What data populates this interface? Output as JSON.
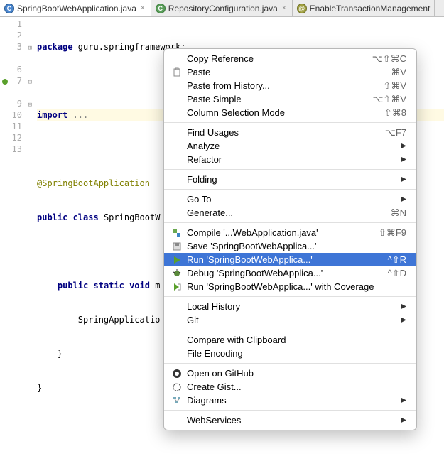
{
  "tabs": [
    {
      "label": "SpringBootWebApplication.java",
      "icon": "C",
      "iconClass": "file-icon-java"
    },
    {
      "label": "RepositoryConfiguration.java",
      "icon": "C",
      "iconClass": "file-icon-intf"
    },
    {
      "label": "EnableTransactionManagement",
      "icon": "@",
      "iconClass": "file-icon-ann"
    }
  ],
  "gutter": [
    "1",
    "2",
    "3",
    "",
    "6",
    "7",
    "",
    "9",
    "10",
    "11",
    "12",
    "13"
  ],
  "code": {
    "l1_kw": "package",
    "l1_rest": " guru.springframework;",
    "l3_kw": "import",
    "l3_rest": " ...",
    "l6": "@SpringBootApplication",
    "l7_kw1": "public",
    "l7_kw2": " class",
    "l7_rest": " SpringBootW",
    "l9_kw1": "public",
    "l9_kw2": " static",
    "l9_kw3": " void",
    "l9_rest": " m",
    "l10": "        SpringApplicatio",
    "l11": "    }",
    "l12": "}"
  },
  "menu": {
    "copy_reference": "Copy Reference",
    "copy_reference_sc": "⌥⇧⌘C",
    "paste": "Paste",
    "paste_sc": "⌘V",
    "paste_history": "Paste from History...",
    "paste_history_sc": "⇧⌘V",
    "paste_simple": "Paste Simple",
    "paste_simple_sc": "⌥⇧⌘V",
    "column_mode": "Column Selection Mode",
    "column_mode_sc": "⇧⌘8",
    "find_usages": "Find Usages",
    "find_usages_sc": "⌥F7",
    "analyze": "Analyze",
    "refactor": "Refactor",
    "folding": "Folding",
    "goto": "Go To",
    "generate": "Generate...",
    "generate_sc": "⌘N",
    "compile": "Compile '...WebApplication.java'",
    "compile_sc": "⇧⌘F9",
    "save": "Save 'SpringBootWebApplica...'",
    "run": "Run 'SpringBootWebApplica...'",
    "run_sc": "^⇧R",
    "debug": "Debug 'SpringBootWebApplica...'",
    "debug_sc": "^⇧D",
    "run_coverage": "Run 'SpringBootWebApplica...' with Coverage",
    "local_history": "Local History",
    "git": "Git",
    "compare_clipboard": "Compare with Clipboard",
    "file_encoding": "File Encoding",
    "open_github": "Open on GitHub",
    "create_gist": "Create Gist...",
    "diagrams": "Diagrams",
    "webservices": "WebServices"
  }
}
